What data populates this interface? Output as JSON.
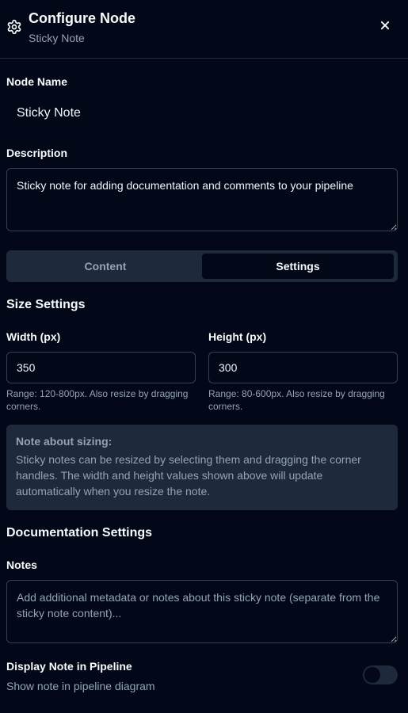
{
  "header": {
    "title": "Configure Node",
    "subtitle": "Sticky Note",
    "icon": "gear-icon",
    "close_icon": "close-icon"
  },
  "node_name": {
    "label": "Node Name",
    "value": "Sticky Note"
  },
  "description": {
    "label": "Description",
    "value": "Sticky note for adding documentation and comments to your pipeline"
  },
  "tabs": [
    {
      "label": "Content",
      "active": false
    },
    {
      "label": "Settings",
      "active": true
    }
  ],
  "size_settings": {
    "title": "Size Settings",
    "width": {
      "label": "Width (px)",
      "value": "350",
      "hint": "Range: 120-800px. Also resize by dragging corners."
    },
    "height": {
      "label": "Height (px)",
      "value": "300",
      "hint": "Range: 80-600px. Also resize by dragging corners."
    },
    "note": {
      "title": "Note about sizing:",
      "text": "Sticky notes can be resized by selecting them and dragging the corner handles. The width and height values shown above will update automatically when you resize the note."
    }
  },
  "documentation": {
    "title": "Documentation Settings",
    "notes_label": "Notes",
    "notes_placeholder": "Add additional metadata or notes about this sticky note (separate from the sticky note content)...",
    "notes_value": "",
    "display_label": "Display Note in Pipeline",
    "display_description": "Show note in pipeline diagram",
    "display_enabled": false
  },
  "colors": {
    "background": "#020817",
    "border": "#334155",
    "muted": "#94a3b8",
    "panel": "#1e293b"
  }
}
